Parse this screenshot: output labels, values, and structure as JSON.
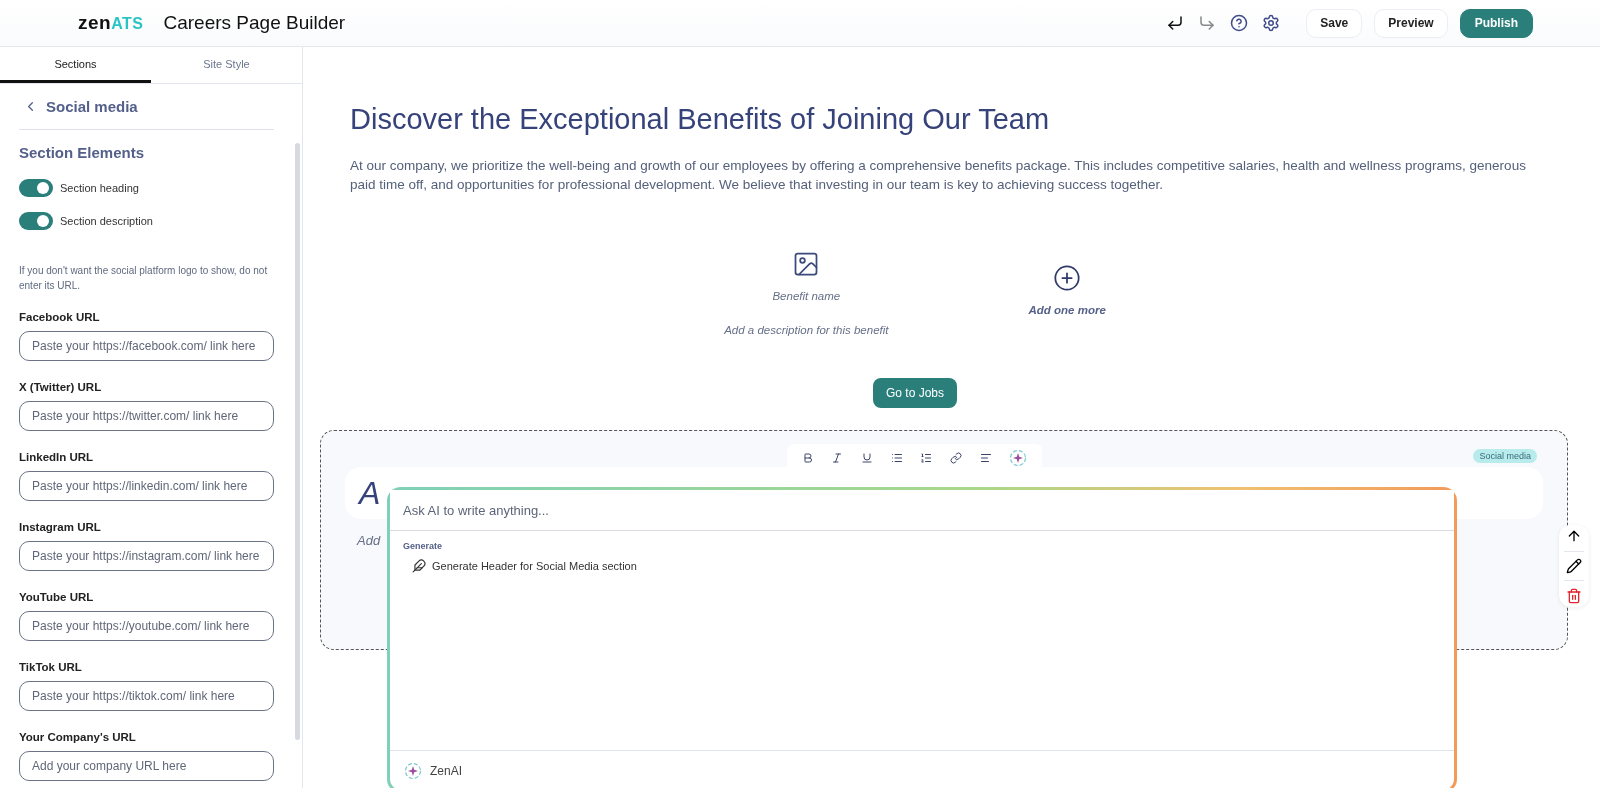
{
  "header": {
    "logo_main": "zen",
    "logo_accent": "ATS",
    "title": "Careers Page Builder",
    "buttons": [
      {
        "label": "Save",
        "kind": "outline"
      },
      {
        "label": "Preview",
        "kind": "outline"
      },
      {
        "label": "Publish",
        "kind": "primary"
      }
    ]
  },
  "sidebar": {
    "tabs": [
      {
        "label": "Sections",
        "selected": true
      },
      {
        "label": "Site Style",
        "selected": false
      }
    ],
    "back_label": "Social media",
    "elements_title": "Section Elements",
    "toggles": [
      {
        "label": "Section heading",
        "on": true
      },
      {
        "label": "Section description",
        "on": true
      }
    ],
    "note": "If you don't want the social platform logo to show, do not enter its URL.",
    "fields": [
      {
        "label": "Facebook URL",
        "placeholder": "Paste your https://facebook.com/ link here"
      },
      {
        "label": "X (Twitter) URL",
        "placeholder": "Paste your https://twitter.com/ link here"
      },
      {
        "label": "LinkedIn URL",
        "placeholder": "Paste your https://linkedin.com/ link here"
      },
      {
        "label": "Instagram URL",
        "placeholder": "Paste your https://instagram.com/ link here"
      },
      {
        "label": "YouTube URL",
        "placeholder": "Paste your https://youtube.com/ link here"
      },
      {
        "label": "TikTok URL",
        "placeholder": "Paste your https://tiktok.com/ link here"
      },
      {
        "label": "Your Company's URL",
        "placeholder": "Add your company URL here"
      }
    ]
  },
  "canvas": {
    "heading": "Discover the Exceptional Benefits of Joining Our Team",
    "description": "At our company, we prioritize the well-being and growth of our employees by offering a comprehensive benefits package. This includes competitive salaries, health and wellness programs, generous paid time off, and opportunities for professional development. We believe that investing in our team is key to achieving success together.",
    "benefit": {
      "name": "Benefit name",
      "description": "Add a description for this benefit"
    },
    "add_more": "Add one more",
    "cta": "Go to Jobs",
    "social_section": {
      "tag": "Social media",
      "heading": "A",
      "description": "Add"
    }
  },
  "ai_popup": {
    "placeholder": "Ask AI to write anything...",
    "group_label": "Generate",
    "suggestions": [
      "Generate Header for Social Media section"
    ],
    "footer": "ZenAI"
  }
}
